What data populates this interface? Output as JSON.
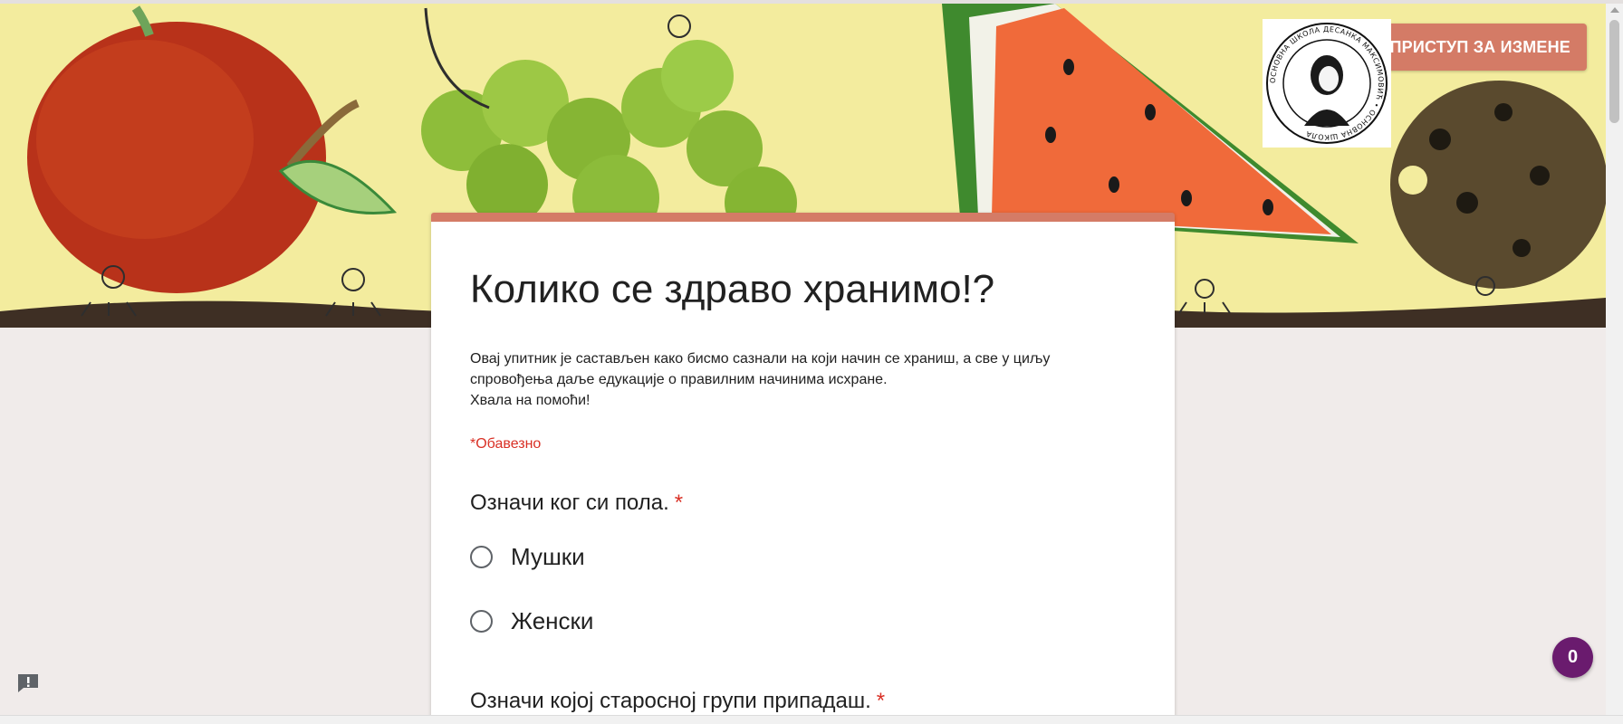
{
  "header": {
    "edit_button_label": "ЗАТРАЖИ ПРИСТУП ЗА ИЗМЕНЕ",
    "school_logo_text": "ОСНОВНА ШКОЛА ДЕСАНКА МАКСИМОВИЋ"
  },
  "form": {
    "title": "Колико се здраво хранимо!?",
    "description": [
      "Овај упитник је састављен како бисмо сазнали на који начин се храниш, а све у циљу",
      "спровођења даље едукације о правилним начинима исхране.",
      "Хвала на помоћи!"
    ],
    "required_note": "*Обавезно",
    "questions": [
      {
        "text": "Означи ког си пола.",
        "required_mark": "*",
        "options": [
          "Мушки",
          "Женски"
        ]
      },
      {
        "text": "Означи којој старосној групи припадаш.",
        "required_mark": "*"
      }
    ]
  },
  "widgets": {
    "counter_badge": "0"
  },
  "colors": {
    "accent": "#d47b66",
    "required": "#d93025",
    "badge": "#6a1b6e",
    "page_background": "#f0ebea"
  }
}
